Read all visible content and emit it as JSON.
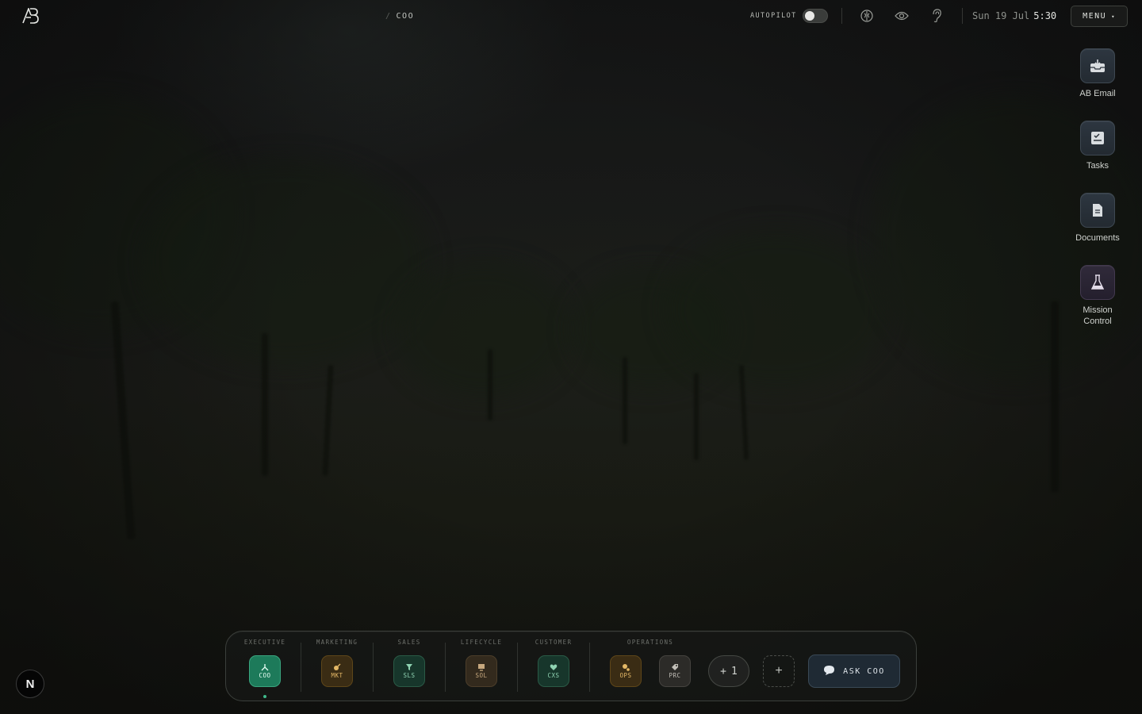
{
  "header": {
    "logo": "AB",
    "breadcrumb_sep": "/",
    "breadcrumb_current": "COO",
    "autopilot_label": "AUTOPILOT",
    "autopilot_on": false,
    "date": "Sun 19 Jul",
    "time": "5:30",
    "menu_label": "MENU",
    "menu_caret": "▾"
  },
  "dock": [
    {
      "label": "AB Email",
      "icon": "inbox-icon"
    },
    {
      "label": "Tasks",
      "icon": "checklist-icon"
    },
    {
      "label": "Documents",
      "icon": "document-icon"
    },
    {
      "label": "Mission Control",
      "icon": "flask-icon"
    }
  ],
  "bottom_bar": {
    "groups": [
      "EXECUTIVE",
      "MARKETING",
      "SALES",
      "LIFECYCLE",
      "CUSTOMER",
      "OPERATIONS"
    ],
    "agents": [
      {
        "code": "COO",
        "group": "EXECUTIVE",
        "active": true,
        "color": "#1d7a5a"
      },
      {
        "code": "MKT",
        "group": "MARKETING",
        "color": "#3a2c14"
      },
      {
        "code": "SLS",
        "group": "SALES",
        "color": "#17362b"
      },
      {
        "code": "SOL",
        "group": "LIFECYCLE",
        "color": "#332a1d"
      },
      {
        "code": "CXS",
        "group": "CUSTOMER",
        "color": "#17362b"
      },
      {
        "code": "OPS",
        "group": "OPERATIONS",
        "color": "#3a2c14"
      },
      {
        "code": "PRC",
        "group": "OPERATIONS",
        "color": "#2c2b28"
      }
    ],
    "more_plus": "+",
    "more_count": "1",
    "add_label": "+",
    "ask_label": "ASK COO"
  },
  "corner_badge": "N"
}
